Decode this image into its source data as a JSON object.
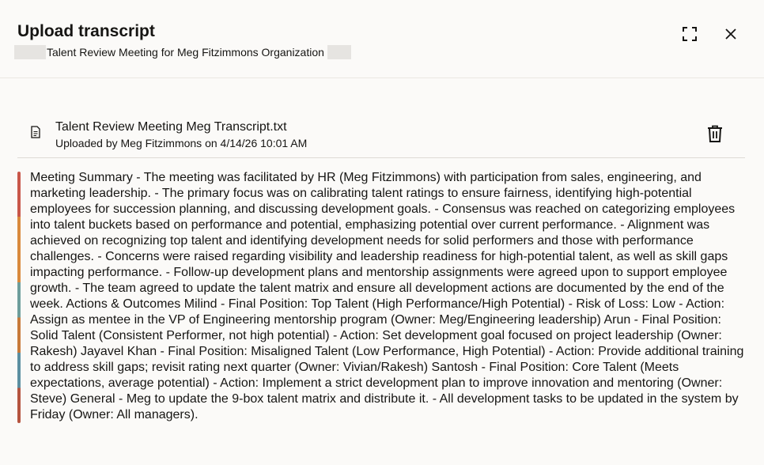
{
  "dialog": {
    "title": "Upload transcript",
    "subtitle": "Talent Review Meeting for Meg Fitzimmons Organization",
    "expand_icon": "expand-icon",
    "close_icon": "close-icon"
  },
  "file": {
    "icon": "document-icon",
    "name": "Talent Review Meeting Meg Transcript.txt",
    "meta": "Uploaded by Meg Fitzimmons on 4/14/26 10:01 AM",
    "delete_icon": "trash-icon"
  },
  "transcript": {
    "text": "Meeting Summary - The meeting was facilitated by HR (Meg Fitzimmons) with participation from sales, engineering, and marketing leadership. - The primary focus was on calibrating talent ratings to ensure fairness, identifying high-potential employees for succession planning, and discussing development goals. - Consensus was reached on categorizing employees into talent buckets based on performance and potential, emphasizing potential over current performance. - Alignment was achieved on recognizing top talent and identifying development needs for solid performers and those with performance challenges. - Concerns were raised regarding visibility and leadership readiness for high-potential talent, as well as skill gaps impacting performance. - Follow-up development plans and mentorship assignments were agreed upon to support employee growth. - The team agreed to update the talent matrix and ensure all development actions are documented by the end of the week. Actions & Outcomes Milind - Final Position: Top Talent (High Performance/High Potential) - Risk of Loss: Low - Action: Assign as mentee in the VP of Engineering mentorship program (Owner: Meg/Engineering leadership) Arun - Final Position: Solid Talent (Consistent Performer, not high potential) - Action: Set development goal focused on project leadership (Owner: Rakesh) Jayavel Khan - Final Position: Misaligned Talent (Low Performance, High Potential) - Action: Provide additional training to address skill gaps; revisit rating next quarter (Owner: Vivian/Rakesh) Santosh - Final Position: Core Talent (Meets expectations, average potential) - Action: Implement a strict development plan to improve innovation and mentoring (Owner: Steve) General - Meg to update the 9-box talent matrix and distribute it. - All development tasks to be updated in the system by Friday (Owner: All managers)."
  }
}
